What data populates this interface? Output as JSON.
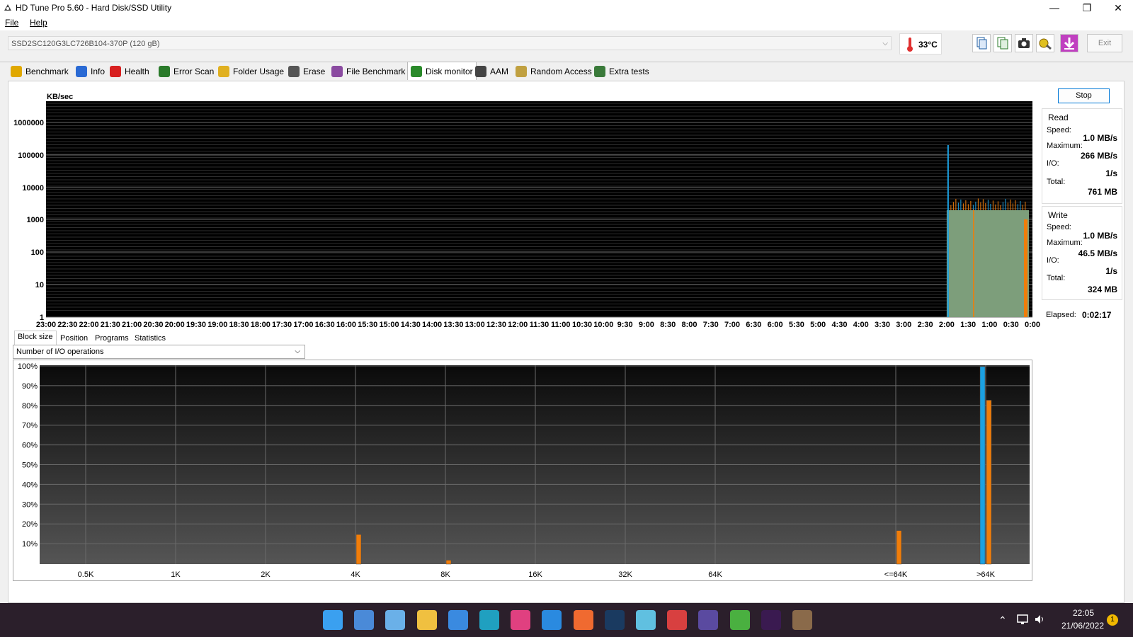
{
  "window": {
    "title": "HD Tune Pro 5.60 - Hard Disk/SSD Utility",
    "min_glyph": "—",
    "max_glyph": "❐",
    "close_glyph": "✕"
  },
  "menu": {
    "file": "File",
    "help": "Help"
  },
  "drive": {
    "selected": "SSD2SC120G3LC726B104-370P (120 gB)",
    "temperature": "33°C",
    "exit_label": "Exit"
  },
  "toolbar_icons": [
    "copy-icon",
    "copy-all-icon",
    "camera-icon",
    "options-icon",
    "download-icon"
  ],
  "tabs": [
    {
      "label": "Benchmark",
      "icon": "benchmark-icon",
      "color": "#e0a800"
    },
    {
      "label": "Info",
      "icon": "info-icon",
      "color": "#2a6ad4"
    },
    {
      "label": "Health",
      "icon": "health-icon",
      "color": "#d82020"
    },
    {
      "label": "Error Scan",
      "icon": "magnifier-icon",
      "color": "#2a7a2a"
    },
    {
      "label": "Folder Usage",
      "icon": "folder-icon",
      "color": "#e0b020"
    },
    {
      "label": "Erase",
      "icon": "trash-icon",
      "color": "#555555"
    },
    {
      "label": "File Benchmark",
      "icon": "file-benchmark-icon",
      "color": "#8a4aa0"
    },
    {
      "label": "Disk monitor",
      "icon": "disk-monitor-icon",
      "color": "#2a8a2a"
    },
    {
      "label": "AAM",
      "icon": "speaker-icon",
      "color": "#444444"
    },
    {
      "label": "Random Access",
      "icon": "random-access-icon",
      "color": "#c0a040"
    },
    {
      "label": "Extra tests",
      "icon": "extra-tests-icon",
      "color": "#3a7a3a"
    }
  ],
  "active_tab": "Disk monitor",
  "monitor_chart": {
    "unit": "KB/sec",
    "y_ticks": [
      "1000000",
      "100000",
      "10000",
      "1000",
      "100",
      "10",
      "1"
    ],
    "x_ticks": [
      "23:00",
      "22:30",
      "22:00",
      "21:30",
      "21:00",
      "20:30",
      "20:00",
      "19:30",
      "19:00",
      "18:30",
      "18:00",
      "17:30",
      "17:00",
      "16:30",
      "16:00",
      "15:30",
      "15:00",
      "14:30",
      "14:00",
      "13:30",
      "13:00",
      "12:30",
      "12:00",
      "11:30",
      "11:00",
      "10:30",
      "10:00",
      "9:30",
      "9:00",
      "8:30",
      "8:00",
      "7:30",
      "7:00",
      "6:30",
      "6:00",
      "5:30",
      "5:00",
      "4:30",
      "4:00",
      "3:30",
      "3:00",
      "2:30",
      "2:00",
      "1:30",
      "1:00",
      "0:30",
      "0:00"
    ]
  },
  "stop_label": "Stop",
  "read": {
    "heading": "Read",
    "speed_label": "Speed:",
    "speed": "1.0 MB/s",
    "max_label": "Maximum:",
    "max": "266 MB/s",
    "io_label": "I/O:",
    "io": "1/s",
    "total_label": "Total:",
    "total": "761 MB"
  },
  "write": {
    "heading": "Write",
    "speed_label": "Speed:",
    "speed": "1.0 MB/s",
    "max_label": "Maximum:",
    "max": "46.5 MB/s",
    "io_label": "I/O:",
    "io": "1/s",
    "total_label": "Total:",
    "total": "324 MB"
  },
  "elapsed": {
    "label": "Elapsed:",
    "value": "0:02:17"
  },
  "subtabs": [
    "Block size",
    "Position",
    "Programs",
    "Statistics"
  ],
  "active_subtab": "Block size",
  "metric_select": "Number of I/O operations",
  "chart_data": {
    "type": "bar",
    "categories": [
      "0.5K",
      "1K",
      "2K",
      "4K",
      "8K",
      "16K",
      "32K",
      "64K",
      "<=64K",
      ">64K"
    ],
    "y_ticks": [
      "100%",
      "90%",
      "80%",
      "70%",
      "60%",
      "50%",
      "40%",
      "30%",
      "20%",
      "10%"
    ],
    "ylim": [
      0,
      100
    ],
    "series": [
      {
        "color": "#1ba1e2",
        "values": [
          0,
          0,
          0,
          0,
          0,
          0,
          0,
          0,
          0,
          100
        ]
      },
      {
        "color": "#f07d0a",
        "values": [
          0,
          0,
          0,
          15,
          2,
          0,
          0,
          0,
          17,
          83
        ]
      }
    ]
  },
  "taskbar": {
    "time": "22:05",
    "date": "21/06/2022",
    "notification_count": "1",
    "apps": [
      {
        "name": "start-icon",
        "color": "#3aa0f0"
      },
      {
        "name": "notepad-icon",
        "color": "#4a8ad8"
      },
      {
        "name": "control-panel-icon",
        "color": "#6ab0e8"
      },
      {
        "name": "file-explorer-icon",
        "color": "#f0c040"
      },
      {
        "name": "mail-icon",
        "color": "#3a8ae0"
      },
      {
        "name": "edge-icon",
        "color": "#20a0c0"
      },
      {
        "name": "intellij-icon",
        "color": "#e04080"
      },
      {
        "name": "vscode-icon",
        "color": "#2a8ae0"
      },
      {
        "name": "postman-icon",
        "color": "#f06a30"
      },
      {
        "name": "photoshop-icon",
        "color": "#1a3a60"
      },
      {
        "name": "paint-icon",
        "color": "#60c0e0"
      },
      {
        "name": "snipping-tool-icon",
        "color": "#d84040"
      },
      {
        "name": "affinity-icon",
        "color": "#5a4aa0"
      },
      {
        "name": "android-studio-icon",
        "color": "#4ab040"
      },
      {
        "name": "premiere-icon",
        "color": "#3a1a50"
      },
      {
        "name": "hdtune-icon",
        "color": "#8a6a4a"
      }
    ],
    "tray_icons": [
      "chevron-up-icon",
      "network-icon",
      "volume-icon"
    ]
  }
}
